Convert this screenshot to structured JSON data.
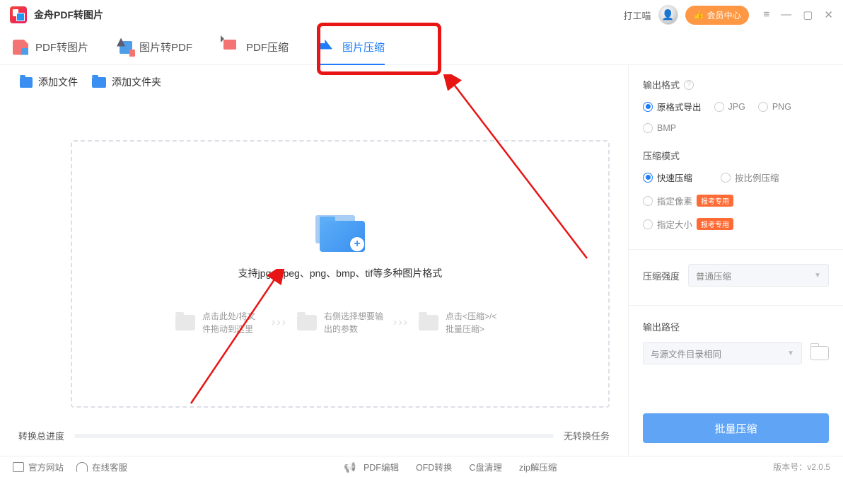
{
  "app": {
    "title": "金舟PDF转图片"
  },
  "titlebar": {
    "username": "打工喵",
    "vip_button": "会员中心"
  },
  "tabs": [
    {
      "label": "PDF转图片"
    },
    {
      "label": "图片转PDF"
    },
    {
      "label": "PDF压缩"
    },
    {
      "label": "图片压缩"
    }
  ],
  "toolbar": {
    "add_file": "添加文件",
    "add_folder": "添加文件夹"
  },
  "dropzone": {
    "support_text": "支持jpg、jpeg、png、bmp、tif等多种图片格式",
    "step1": "点击此处/将文件拖动到这里",
    "step2": "右侧选择想要输出的参数",
    "step3": "点击<压缩>/<批量压缩>"
  },
  "progress": {
    "label": "转换总进度",
    "status": "无转换任务"
  },
  "settings": {
    "output_format": {
      "title": "输出格式",
      "options": [
        "原格式导出",
        "JPG",
        "PNG",
        "BMP"
      ],
      "selected": "原格式导出"
    },
    "compress_mode": {
      "title": "压缩模式",
      "fast": "快速压缩",
      "ratio": "按比例压缩",
      "pixel": "指定像素",
      "size": "指定大小",
      "badge": "报考专用",
      "selected": "快速压缩"
    },
    "strength": {
      "title": "压缩强度",
      "value": "普通压缩"
    },
    "output_path": {
      "title": "输出路径",
      "value": "与源文件目录相同"
    }
  },
  "batch_button": "批量压缩",
  "footer": {
    "official": "官方网站",
    "support": "在线客服",
    "links": [
      "PDF编辑",
      "OFD转换",
      "C盘清理",
      "zip解压缩"
    ],
    "version_label": "版本号：",
    "version": "v2.0.5"
  }
}
